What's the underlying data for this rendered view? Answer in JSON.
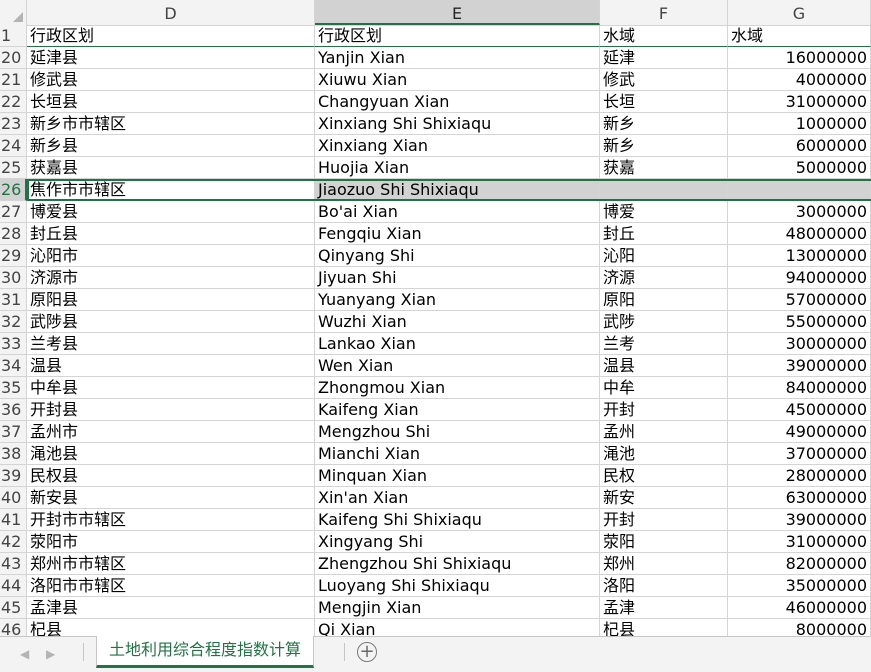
{
  "columns": [
    "D",
    "E",
    "F",
    "G"
  ],
  "selected_column": "E",
  "header_row": {
    "num": "1",
    "d": "行政区划",
    "e": "行政区划",
    "f": "水域",
    "g": "水域"
  },
  "rows": [
    {
      "num": "20",
      "d": "延津县",
      "e": "Yanjin Xian",
      "f": "延津",
      "g": "16000000"
    },
    {
      "num": "21",
      "d": "修武县",
      "e": "Xiuwu Xian",
      "f": "修武",
      "g": "4000000"
    },
    {
      "num": "22",
      "d": "长垣县",
      "e": "Changyuan Xian",
      "f": "长垣",
      "g": "31000000"
    },
    {
      "num": "23",
      "d": "新乡市市辖区",
      "e": "Xinxiang Shi Shixiaqu",
      "f": "新乡",
      "g": "1000000"
    },
    {
      "num": "24",
      "d": "新乡县",
      "e": "Xinxiang Xian",
      "f": "新乡",
      "g": "6000000"
    },
    {
      "num": "25",
      "d": "获嘉县",
      "e": "Huojia Xian",
      "f": "获嘉",
      "g": "5000000"
    },
    {
      "num": "26",
      "d": "焦作市市辖区",
      "e": "Jiaozuo Shi Shixiaqu",
      "f": "",
      "g": ""
    },
    {
      "num": "27",
      "d": "博爱县",
      "e": "Bo'ai Xian",
      "f": "博爱",
      "g": "3000000"
    },
    {
      "num": "28",
      "d": "封丘县",
      "e": "Fengqiu Xian",
      "f": "封丘",
      "g": "48000000"
    },
    {
      "num": "29",
      "d": "沁阳市",
      "e": "Qinyang Shi",
      "f": "沁阳",
      "g": "13000000"
    },
    {
      "num": "30",
      "d": "济源市",
      "e": "Jiyuan Shi",
      "f": "济源",
      "g": "94000000"
    },
    {
      "num": "31",
      "d": "原阳县",
      "e": "Yuanyang Xian",
      "f": "原阳",
      "g": "57000000"
    },
    {
      "num": "32",
      "d": "武陟县",
      "e": "Wuzhi Xian",
      "f": "武陟",
      "g": "55000000"
    },
    {
      "num": "33",
      "d": "兰考县",
      "e": "Lankao Xian",
      "f": "兰考",
      "g": "30000000"
    },
    {
      "num": "34",
      "d": "温县",
      "e": "Wen Xian",
      "f": "温县",
      "g": "39000000"
    },
    {
      "num": "35",
      "d": "中牟县",
      "e": "Zhongmou Xian",
      "f": "中牟",
      "g": "84000000"
    },
    {
      "num": "36",
      "d": "开封县",
      "e": "Kaifeng Xian",
      "f": "开封",
      "g": "45000000"
    },
    {
      "num": "37",
      "d": "孟州市",
      "e": "Mengzhou Shi",
      "f": "孟州",
      "g": "49000000"
    },
    {
      "num": "38",
      "d": "渑池县",
      "e": "Mianchi Xian",
      "f": "渑池",
      "g": "37000000"
    },
    {
      "num": "39",
      "d": "民权县",
      "e": "Minquan Xian",
      "f": "民权",
      "g": "28000000"
    },
    {
      "num": "40",
      "d": "新安县",
      "e": "Xin'an Xian",
      "f": "新安",
      "g": "63000000"
    },
    {
      "num": "41",
      "d": "开封市市辖区",
      "e": "Kaifeng Shi Shixiaqu",
      "f": "开封",
      "g": "39000000"
    },
    {
      "num": "42",
      "d": "荥阳市",
      "e": "Xingyang Shi",
      "f": "荥阳",
      "g": "31000000"
    },
    {
      "num": "43",
      "d": "郑州市市辖区",
      "e": "Zhengzhou Shi Shixiaqu",
      "f": "郑州",
      "g": "82000000"
    },
    {
      "num": "44",
      "d": "洛阳市市辖区",
      "e": "Luoyang Shi Shixiaqu",
      "f": "洛阳",
      "g": "35000000"
    },
    {
      "num": "45",
      "d": "孟津县",
      "e": "Mengjin Xian",
      "f": "孟津",
      "g": "46000000"
    },
    {
      "num": "46",
      "d": "杞县",
      "e": "Qi Xian",
      "f": "杞县",
      "g": "8000000"
    }
  ],
  "selected_row": "26",
  "sheet_tab": "土地利用综合程度指数计算",
  "colors": {
    "accent": "#217346",
    "selection": "#d2d2d2"
  }
}
